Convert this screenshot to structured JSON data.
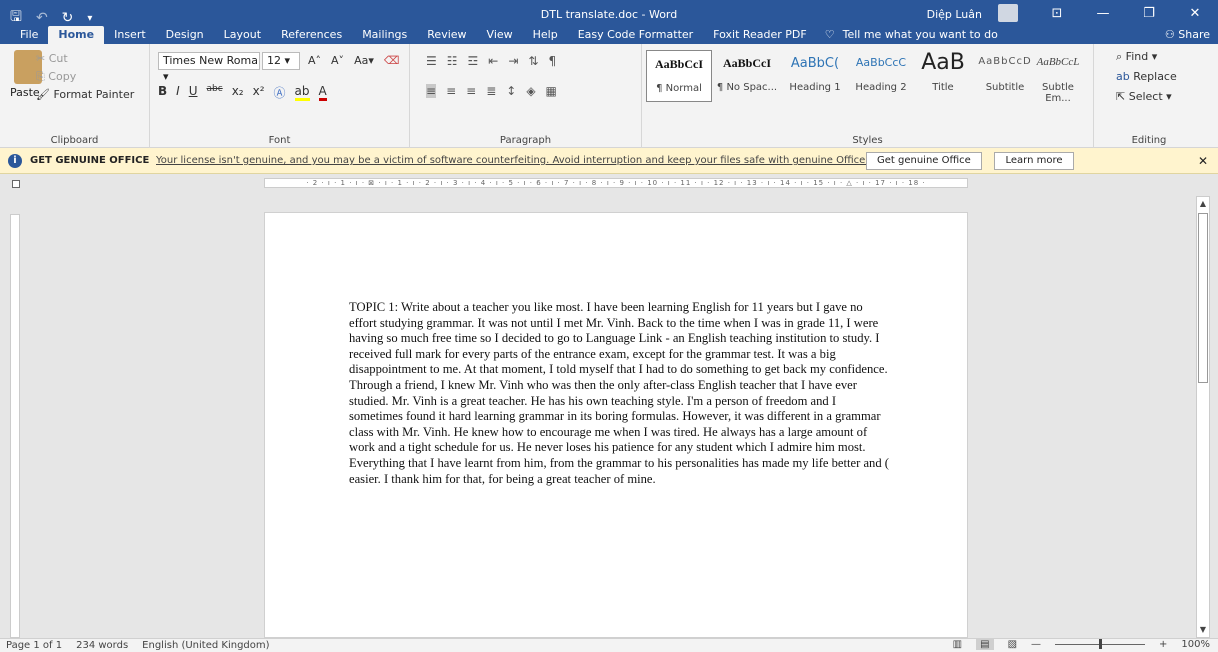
{
  "title": "DTL translate.doc - Word",
  "user": "Diệp Luân",
  "tabs": [
    "File",
    "Home",
    "Insert",
    "Design",
    "Layout",
    "References",
    "Mailings",
    "Review",
    "View",
    "Help",
    "Easy Code Formatter",
    "Foxit Reader PDF"
  ],
  "tell_me": "Tell me what you want to do",
  "share": "Share",
  "clipboard": {
    "paste": "Paste",
    "cut": "Cut",
    "copy": "Copy",
    "format_painter": "Format Painter",
    "label": "Clipboard"
  },
  "font": {
    "name": "Times New Roma",
    "size": "12",
    "label": "Font"
  },
  "paragraph": {
    "label": "Paragraph"
  },
  "styles": {
    "label": "Styles",
    "items": [
      {
        "sample": "AaBbCcI",
        "name": "¶ Normal"
      },
      {
        "sample": "AaBbCcI",
        "name": "¶ No Spac..."
      },
      {
        "sample": "AaBbC(",
        "name": "Heading 1"
      },
      {
        "sample": "AaBbCcC",
        "name": "Heading 2"
      },
      {
        "sample": "AaB",
        "name": "Title"
      },
      {
        "sample": "AaBbCcD",
        "name": "Subtitle"
      },
      {
        "sample": "AaBbCcL",
        "name": "Subtle Em..."
      }
    ]
  },
  "editing": {
    "find": "Find",
    "replace": "Replace",
    "select": "Select",
    "label": "Editing"
  },
  "genuine": {
    "head": "GET GENUINE OFFICE",
    "message": "Your license isn't genuine, and you may be a victim of software counterfeiting. Avoid interruption and keep your files safe with genuine Office today.",
    "get_button": "Get genuine Office",
    "learn_button": "Learn more"
  },
  "ruler_text": "· 2 · ı · 1 · ı · ⊠ · ı · 1 · ı · 2 · ı · 3 · ı · 4 · ı · 5 · ı · 6 · ı · 7 · ı · 8 · ı · 9 · ı · 10 · ı · 11 · ı · 12 · ı · 13 · ı · 14 · ı · 15 · ı · △ · ı · 17 · ı · 18 ·",
  "document": {
    "text": "TOPIC 1: Write about a teacher you like most. I have been learning English for 11 years but I gave no effort studying grammar. It was not until I met Mr. Vinh. Back to the time when I was in grade 11, I were having so much free time so I decided to go to Language Link - an English teaching institution to study. I received full mark for every parts of the entrance exam, except for the grammar test. It was a big disappointment to me. At that moment, I told myself that I had to do something to get back my confidence. Through a friend, I knew Mr. Vinh who was then the only after-class English teacher that I have ever studied. Mr. Vinh is a great teacher. He has his own teaching style. I'm a person of freedom and I sometimes found it hard learning grammar in its boring formulas. However, it was different in a grammar class with Mr. Vinh. He knew how to encourage me when I was tired. He always has a large amount of work and a tight schedule for us. He never loses his patience for any student which I admire him most. Everything that I have learnt from him, from the grammar to his personalities has made my life better and ( easier. I thank him for that, for being a great teacher of mine."
  },
  "status": {
    "page": "Page 1 of 1",
    "words": "234 words",
    "language": "English (United Kingdom)",
    "zoom": "100%"
  },
  "colors": {
    "word_blue": "#2b579a",
    "ribbon": "#f3f3f3",
    "banner": "#fff4ce"
  }
}
